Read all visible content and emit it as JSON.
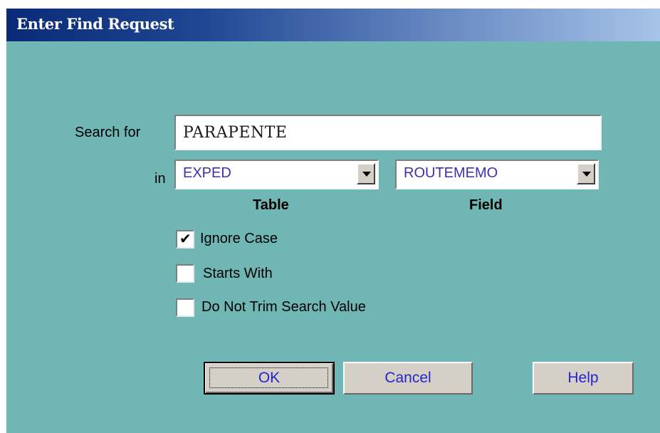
{
  "window": {
    "title": "Enter Find Request"
  },
  "form": {
    "search_label": "Search for",
    "search_value": "PARAPENTE",
    "in_label": "in",
    "table_combo": {
      "value": "EXPED",
      "caption": "Table"
    },
    "field_combo": {
      "value": "ROUTEMEMO",
      "caption": "Field"
    }
  },
  "options": [
    {
      "label": "Ignore Case",
      "checked": true
    },
    {
      "label": "Starts With",
      "checked": false
    },
    {
      "label": "Do Not Trim Search Value",
      "checked": false
    }
  ],
  "buttons": {
    "ok": "OK",
    "cancel": "Cancel",
    "help": "Help"
  },
  "colors": {
    "title_gradient_start": "#0a2a78",
    "title_gradient_end": "#a6c3e8",
    "client_background": "#6fb6b4",
    "combo_text": "#3c2fb0",
    "button_text": "#2525c8",
    "button_face": "#d4d0c8"
  },
  "icons": {
    "dropdown": "chevron-down-icon",
    "checkbox_checked": "checkmark-icon"
  }
}
